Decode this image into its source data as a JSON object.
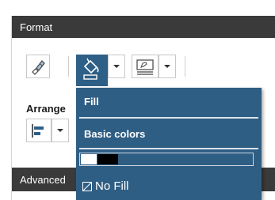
{
  "panel": {
    "format_header": "Format",
    "arrange_label": "Arrange",
    "advanced_header": "Advanced"
  },
  "toolbar": {
    "buttons": [
      {
        "name": "paintbrush-icon"
      },
      {
        "name": "paint-bucket-icon"
      },
      {
        "name": "chevron-down-icon"
      },
      {
        "name": "line-style-icon"
      },
      {
        "name": "chevron-down-icon"
      }
    ]
  },
  "dropdown": {
    "fill_heading": "Fill",
    "basic_colors_heading": "Basic colors",
    "colors": [
      "#ffffff",
      "#000000"
    ],
    "no_fill_label": "No Fill"
  },
  "colors": {
    "header_bg": "#3a3a3a",
    "dropdown_bg": "#2f5e84"
  }
}
